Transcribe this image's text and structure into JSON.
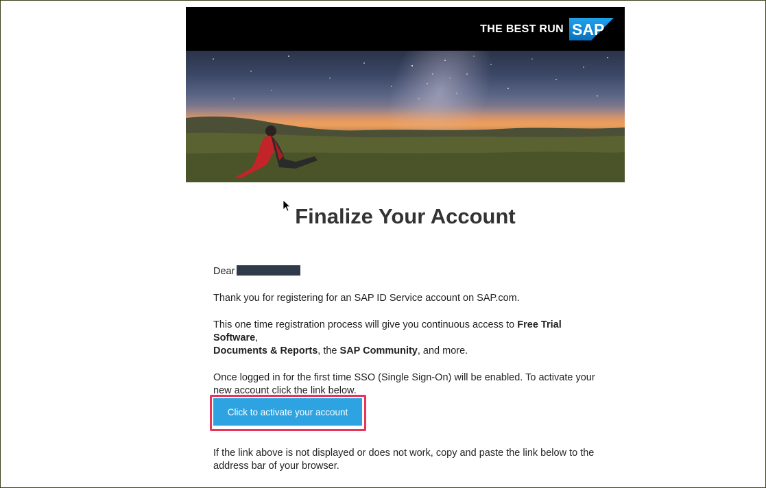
{
  "header": {
    "tagline": "THE BEST RUN",
    "logo_text": "SAP",
    "logo_color": "#1b8fd6"
  },
  "title": "Finalize Your Account",
  "greeting": {
    "label": "Dear",
    "name_redacted": true
  },
  "paragraphs": {
    "thanks": "Thank you for registering for an SAP ID Service account on SAP.com.",
    "access_prefix": "This one time registration process will give you continuous access to ",
    "access_bold_1": "Free Trial Software",
    "access_sep_1": ",",
    "access_bold_2": "Documents & Reports",
    "access_sep_2": ", the ",
    "access_bold_3": "SAP Community",
    "access_suffix": ", and more.",
    "sso": "Once logged in for the first time SSO (Single Sign-On) will be enabled. To activate your new account click the link below."
  },
  "activate_button": {
    "label": "Click to activate your account",
    "bg_color": "#2ea3e1",
    "highlight_color": "#e8335a"
  },
  "footer": {
    "fallback_text": "If the link above is not displayed or does not work, copy and paste the link below to the address bar of your browser."
  }
}
